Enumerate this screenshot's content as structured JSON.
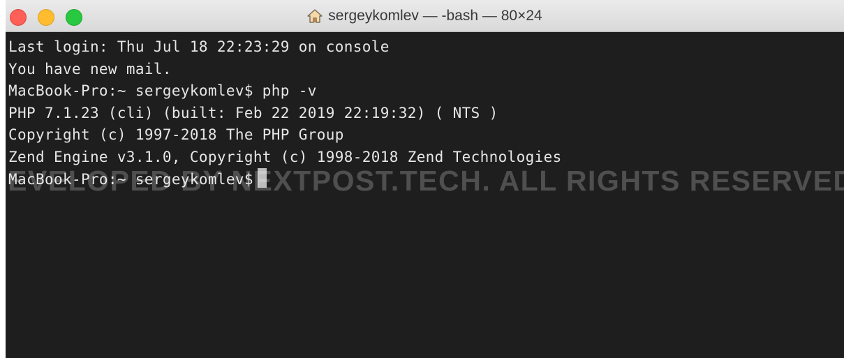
{
  "window": {
    "title": "sergeykomlev — -bash — 80×24",
    "title_icon": "home-icon",
    "traffic_lights": {
      "close": "#fe5f57",
      "minimize": "#febc2e",
      "maximize": "#28c840"
    }
  },
  "terminal": {
    "background": "#1e1e1e",
    "lines": [
      "Last login: Thu Jul 18 22:23:29 on console",
      "You have new mail.",
      "MacBook-Pro:~ sergeykomlev$ php -v",
      "PHP 7.1.23 (cli) (built: Feb 22 2019 22:19:32) ( NTS )",
      "Copyright (c) 1997-2018 The PHP Group",
      "Zend Engine v3.1.0, Copyright (c) 1998-2018 Zend Technologies"
    ],
    "prompt": "MacBook-Pro:~ sergeykomlev$"
  },
  "watermark": "DEVELOPED BY NEXTPOST.TECH. ALL RIGHTS RESERVED"
}
